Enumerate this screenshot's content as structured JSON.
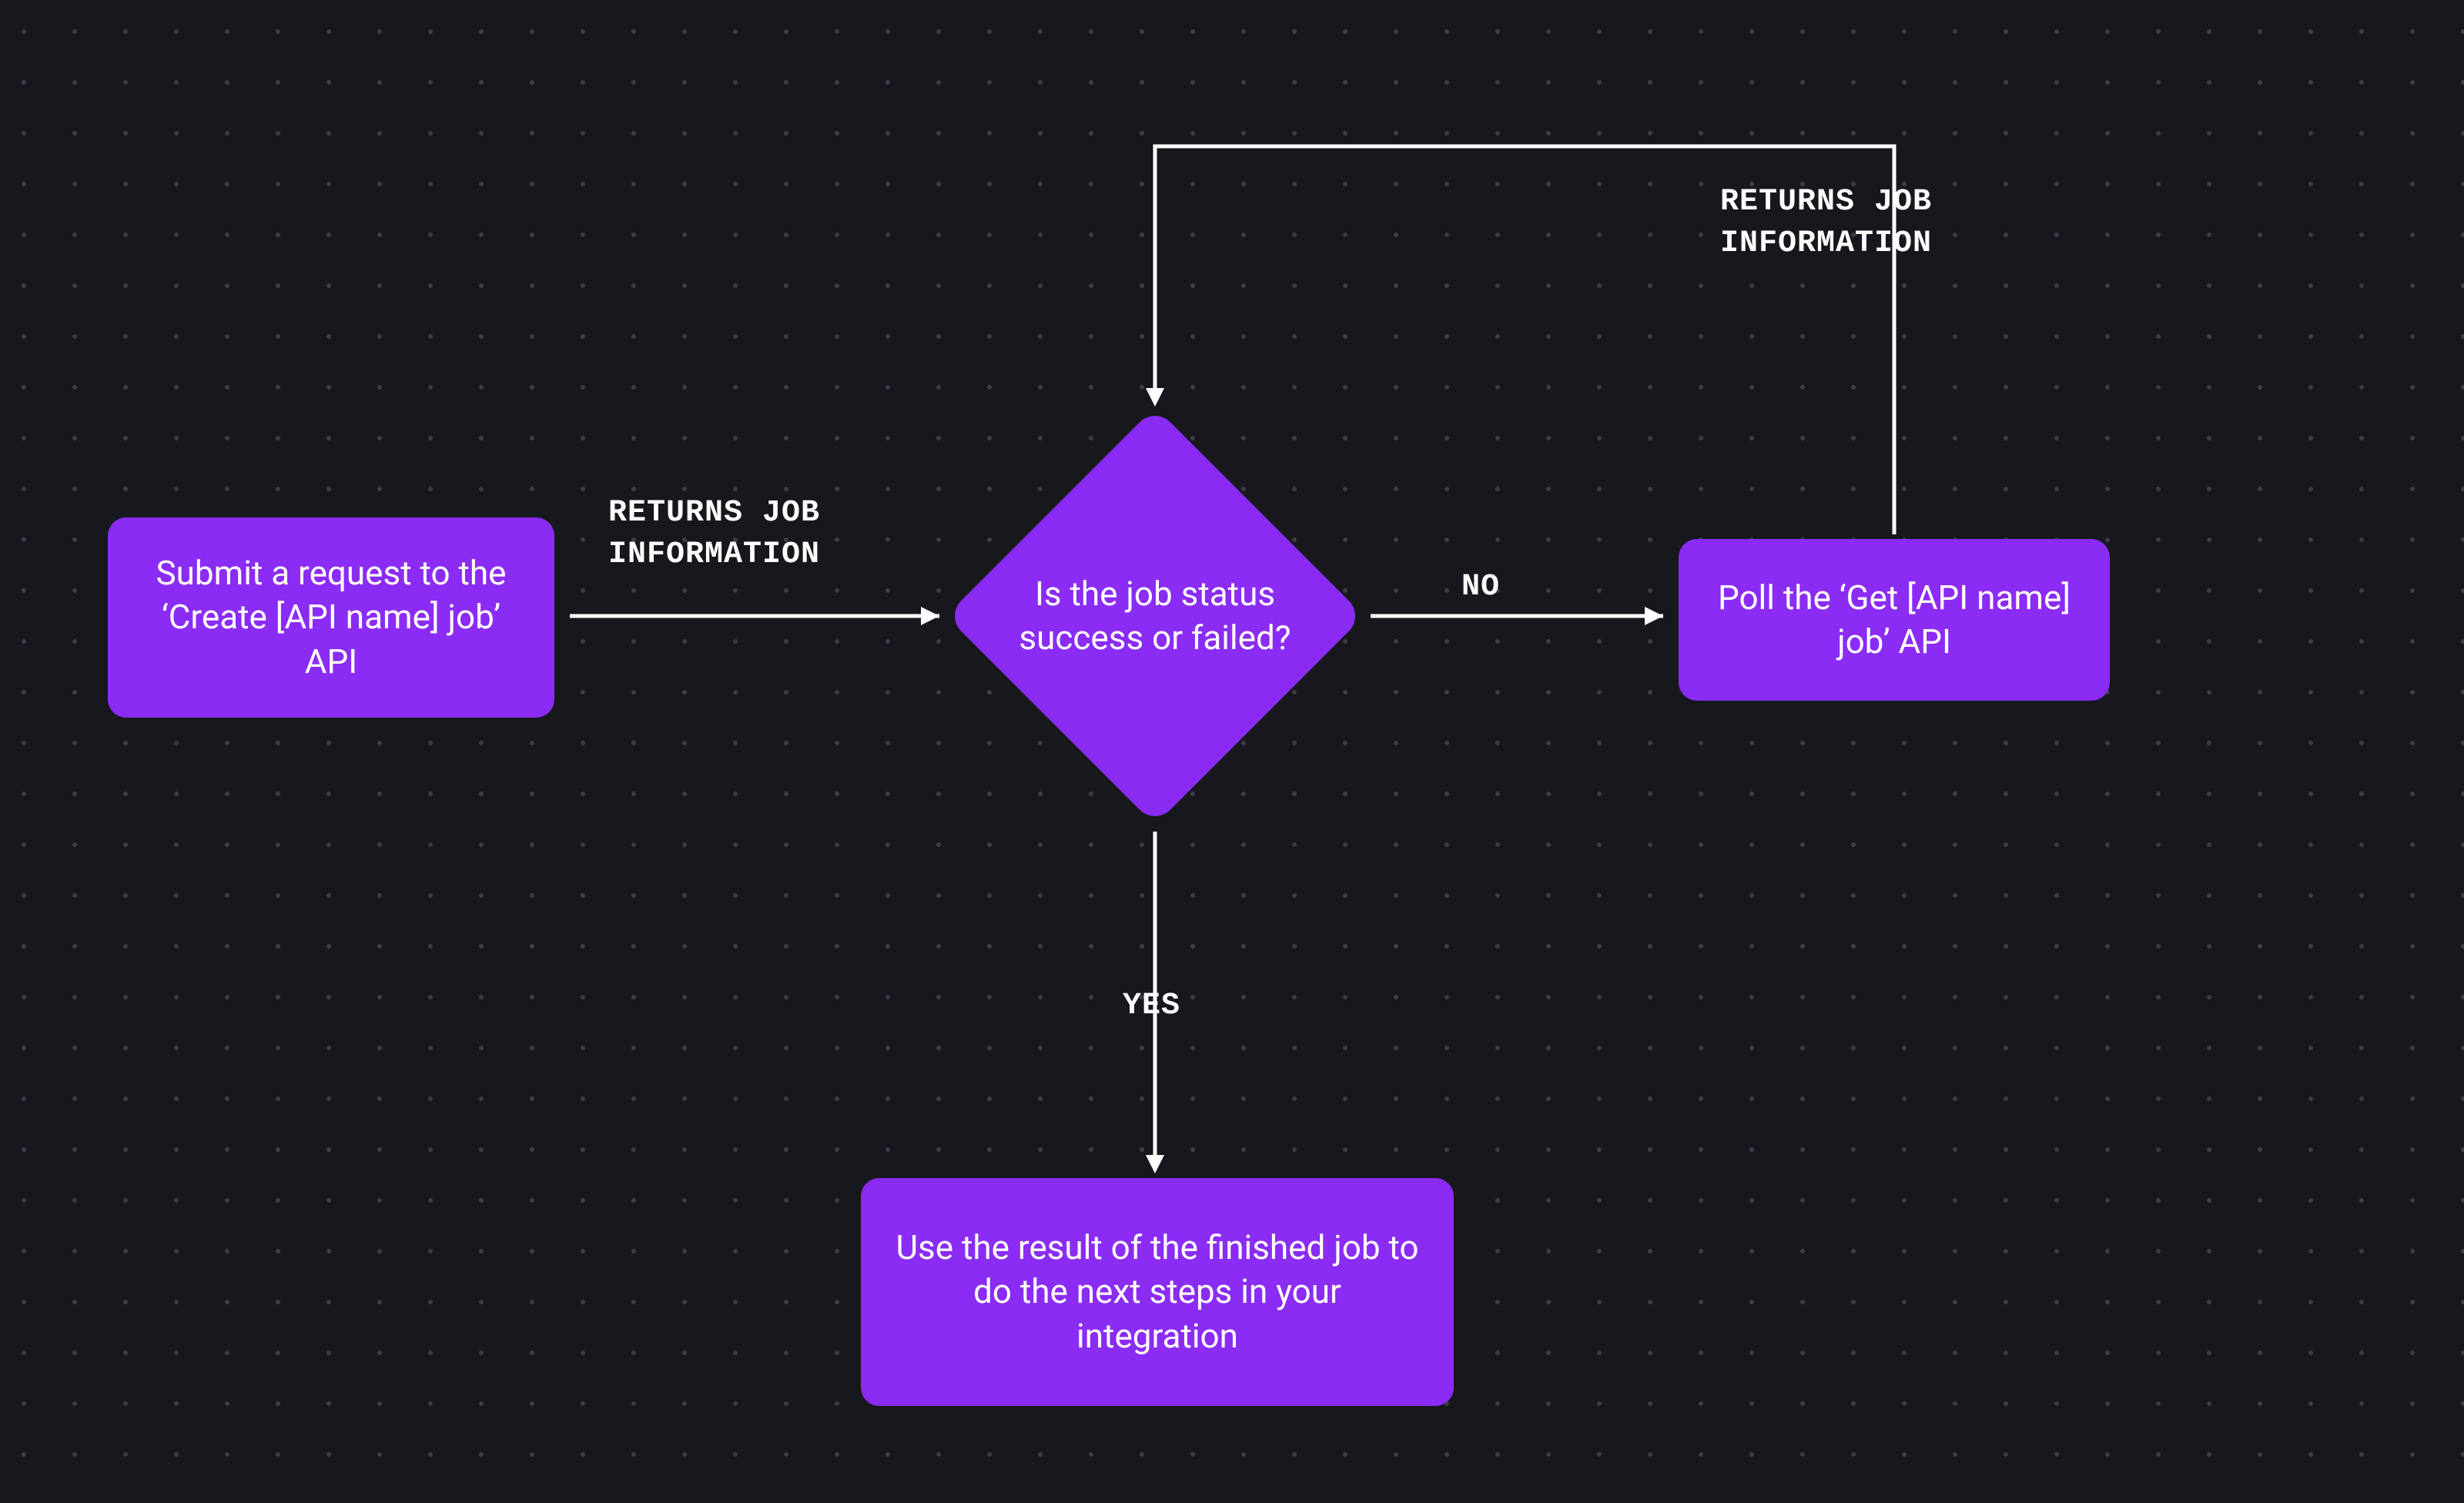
{
  "nodes": {
    "submit": "Submit a request to the ‘Create [API name] job’ API",
    "decision": "Is the job status success or failed?",
    "poll": "Poll the ‘Get [API name] job’ API",
    "result": "Use the result of the finished job to do the next steps in your integration"
  },
  "labels": {
    "returns1": "RETURNS JOB\nINFORMATION",
    "returns2": "RETURNS JOB\nINFORMATION",
    "no": "NO",
    "yes": "YES"
  }
}
